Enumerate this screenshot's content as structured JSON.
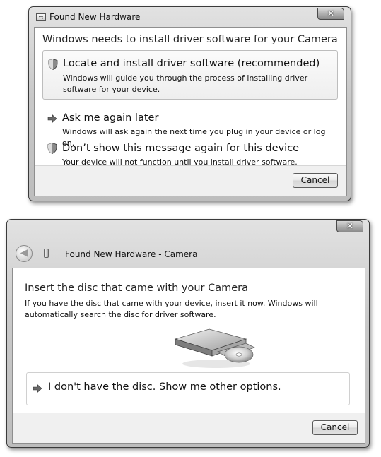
{
  "window1": {
    "title": "Found New Hardware",
    "close_label": "x",
    "heading": "Windows needs to install driver software for your Camera",
    "options": [
      {
        "icon": "shield-icon",
        "title": "Locate and install driver software (recommended)",
        "description": "Windows will guide you through the process of installing driver software for your device."
      },
      {
        "icon": "arrow-icon",
        "title": "Ask me again later",
        "description": "Windows will ask again the next time you plug in your device or log on."
      },
      {
        "icon": "shield-icon",
        "title": "Don’t show this message again for this device",
        "description": "Your device will not function until you install driver software."
      }
    ],
    "cancel_label": "Cancel"
  },
  "window2": {
    "title": "Found New Hardware - Camera",
    "close_label": "x",
    "heading": "Insert the disc that came with your Camera",
    "paragraph": "If you have the disc that came with your device, insert it now.  Windows will automatically search the disc for driver software.",
    "link": "I don't have the disc.  Show me other options.",
    "cancel_label": "Cancel"
  }
}
